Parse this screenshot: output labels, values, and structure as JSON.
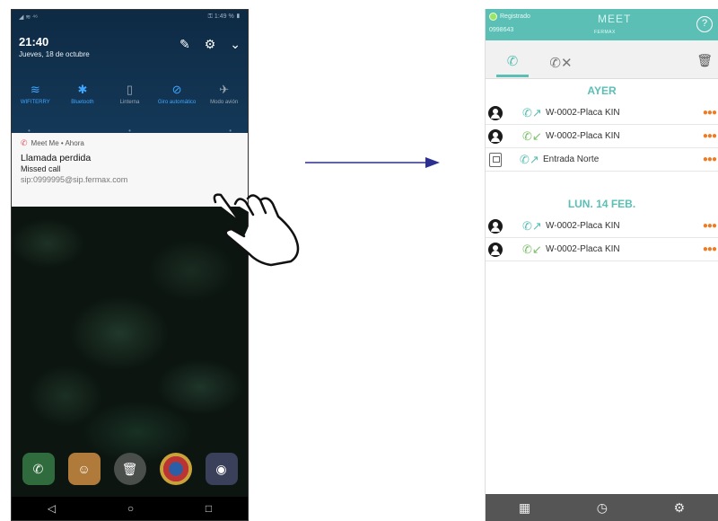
{
  "left_phone": {
    "status_left": "◢ ≋ ⁴⁶",
    "status_right": "⚿ 1:49 % ▮",
    "time": "21:40",
    "date": "Jueves, 18 de octubre",
    "quick_tiles": [
      {
        "icon": "wifi-icon",
        "glyph": "≋",
        "label": "WIFITERRY",
        "state": "on"
      },
      {
        "icon": "bluetooth-icon",
        "glyph": "✱",
        "label": "Bluetooth",
        "state": "on"
      },
      {
        "icon": "flashlight-icon",
        "glyph": "▯",
        "label": "Linterna",
        "state": "off"
      },
      {
        "icon": "auto-rotate-icon",
        "glyph": "⊘",
        "label": "Giro automático",
        "state": "on"
      },
      {
        "icon": "airplane-icon",
        "glyph": "✈",
        "label": "Modo avión",
        "state": "off"
      }
    ],
    "notification": {
      "app": "Meet Me • Ahora",
      "title": "Llamada perdida",
      "subtitle": "Missed call",
      "sip": "sip:0999995@sip.fermax.com"
    }
  },
  "right_phone": {
    "registration_status": "Registrado",
    "device_id": "0998643",
    "brand": "MEET",
    "brand_sub": "FERMAX",
    "sections": [
      {
        "title": "AYER",
        "calls": [
          {
            "caller_type": "person",
            "direction": "outgoing",
            "name": "W-0002-Placa KIN"
          },
          {
            "caller_type": "person",
            "direction": "incoming",
            "name": "W-0002-Placa KIN"
          },
          {
            "caller_type": "panel",
            "direction": "outgoing",
            "name": "Entrada Norte"
          }
        ]
      },
      {
        "title": "LUN. 14 FEB.",
        "calls": [
          {
            "caller_type": "person",
            "direction": "outgoing",
            "name": "W-0002-Placa KIN"
          },
          {
            "caller_type": "person",
            "direction": "incoming",
            "name": "W-0002-Placa KIN"
          }
        ]
      }
    ]
  },
  "colors": {
    "accent": "#5bbfb5",
    "more_dots": "#f07b22",
    "missed": "#e0525b"
  }
}
